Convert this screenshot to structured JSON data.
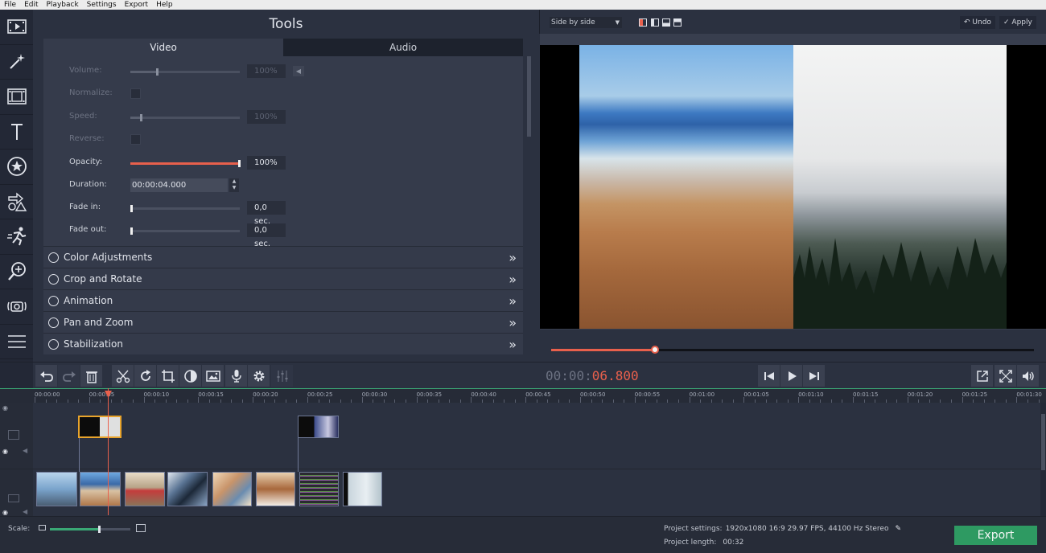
{
  "menu": [
    "File",
    "Edit",
    "Playback",
    "Settings",
    "Export",
    "Help"
  ],
  "sidebar": {
    "items": [
      {
        "icon": "film-import-icon"
      },
      {
        "icon": "magic-wand-icon"
      },
      {
        "icon": "film-clip-icon"
      },
      {
        "icon": "text-icon"
      },
      {
        "icon": "star-sticker-icon"
      },
      {
        "icon": "shapes-icon"
      },
      {
        "icon": "running-man-icon"
      },
      {
        "icon": "zoom-icon"
      },
      {
        "icon": "camera-icon"
      },
      {
        "icon": "list-icon"
      }
    ]
  },
  "tools": {
    "title": "Tools",
    "tabs": [
      {
        "label": "Video"
      },
      {
        "label": "Audio"
      }
    ],
    "props": {
      "volume": {
        "label": "Volume:",
        "value": "100%",
        "level": 0.25
      },
      "normalize": {
        "label": "Normalize:"
      },
      "speed": {
        "label": "Speed:",
        "value": "100%",
        "level": 0.1
      },
      "reverse": {
        "label": "Reverse:"
      },
      "opacity": {
        "label": "Opacity:",
        "value": "100%",
        "level": 1.0
      },
      "duration": {
        "label": "Duration:",
        "value": "00:00:04.000"
      },
      "fade_in": {
        "label": "Fade in:",
        "value": "0,0 sec.",
        "level": 0
      },
      "fade_out": {
        "label": "Fade out:",
        "value": "0,0 sec.",
        "level": 0
      }
    },
    "sections": [
      {
        "label": "Color Adjustments"
      },
      {
        "label": "Crop and Rotate"
      },
      {
        "label": "Animation"
      },
      {
        "label": "Pan and Zoom"
      },
      {
        "label": "Stabilization"
      }
    ],
    "chevron": "»"
  },
  "preview": {
    "layout_select": "Side by side",
    "undo_label": "Undo",
    "apply_label": "Apply",
    "scrub_progress": 0.215,
    "time_dim": "00:00:",
    "time_hot": "06.800"
  },
  "ruler": {
    "labels": [
      "00:00:00",
      "00:00:05",
      "00:00:10",
      "00:00:15",
      "00:00:20",
      "00:00:25",
      "00:00:30",
      "00:00:35",
      "00:00:40",
      "00:00:45",
      "00:00:50",
      "00:00:55",
      "00:01:00",
      "00:01:05",
      "00:01:10",
      "00:01:15",
      "00:01:20",
      "00:01:25",
      "00:01:30"
    ]
  },
  "status": {
    "scale_label": "Scale:",
    "scale_level": 0.62,
    "project_settings_label": "Project settings:",
    "project_settings_value": "1920x1080 16:9 29.97 FPS, 44100 Hz Stereo",
    "project_length_label": "Project length:",
    "project_length_value": "00:32",
    "export_label": "Export"
  },
  "colors": {
    "accent": "#e8604c",
    "export_green": "#2e9a62",
    "panel": "#2b3140",
    "sidebar": "#232836"
  }
}
